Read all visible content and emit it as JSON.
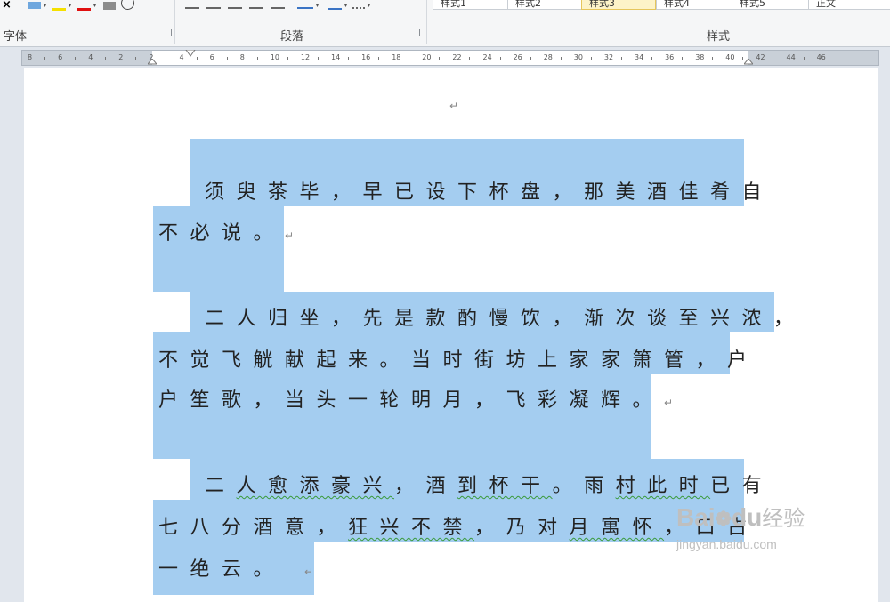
{
  "ribbon": {
    "group_font_label": "字体",
    "group_paragraph_label": "段落",
    "group_styles_label": "样式",
    "styles": [
      "样式1",
      "样式2",
      "样式3",
      "样式4",
      "样式5",
      "正文"
    ]
  },
  "ruler": {
    "ticks": [
      "8",
      "6",
      "4",
      "2",
      "2",
      "4",
      "6",
      "8",
      "10",
      "12",
      "14",
      "16",
      "18",
      "20",
      "22",
      "24",
      "26",
      "28",
      "30",
      "32",
      "34",
      "36",
      "38",
      "40",
      "42",
      "44",
      "46"
    ]
  },
  "document": {
    "top_mark": "↵",
    "para1_line1": "须臾茶毕，早已设下杯盘，那美酒佳肴自",
    "para1_line2": "不必说。",
    "para2_line1": "二人归坐，先是款酌慢饮，渐次谈至兴浓，",
    "para2_line2": "不觉飞觥献起来。当时街坊上家家箫管，户",
    "para2_line3": "户笙歌，当头一轮明月，飞彩凝辉。",
    "para3_line1_a": "二",
    "para3_line1_b": "人愈添豪兴",
    "para3_line1_c": "，酒",
    "para3_line1_d": "到杯干",
    "para3_line1_e": "。雨",
    "para3_line1_f": "村此时",
    "para3_line1_g": "已有",
    "para3_line2_a": "七八分酒意，",
    "para3_line2_b": "狂兴不禁",
    "para3_line2_c": "，乃对",
    "para3_line2_d": "月寓怀",
    "para3_line2_e": "，口占",
    "para3_line3": "一绝云。",
    "para_mark": "↵"
  },
  "watermark": {
    "brand": "Bai",
    "brand2": "du",
    "brand_cn": "经验",
    "url": "jingyan.baidu.com"
  }
}
